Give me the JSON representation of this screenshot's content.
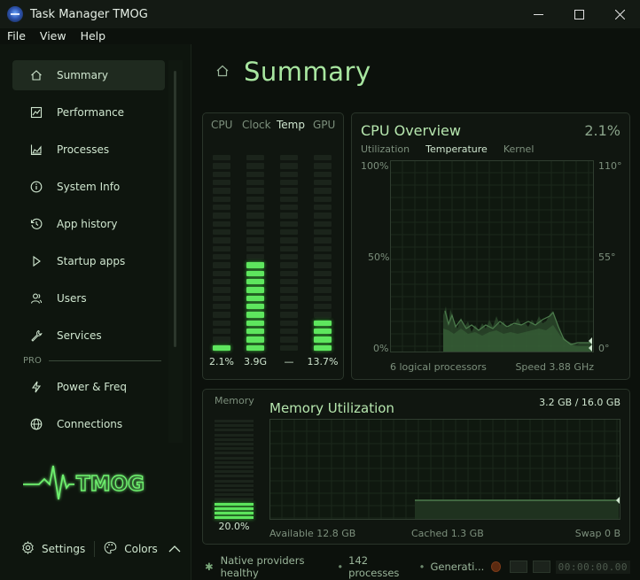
{
  "window": {
    "title": "Task Manager TMOG"
  },
  "menu": [
    "File",
    "View",
    "Help"
  ],
  "sidebar": {
    "items": [
      {
        "label": "Summary",
        "icon": "home-icon",
        "active": true
      },
      {
        "label": "Performance",
        "icon": "chart-icon"
      },
      {
        "label": "Processes",
        "icon": "area-chart-icon"
      },
      {
        "label": "System Info",
        "icon": "info-icon"
      },
      {
        "label": "App history",
        "icon": "history-icon"
      },
      {
        "label": "Startup apps",
        "icon": "play-icon"
      },
      {
        "label": "Users",
        "icon": "users-icon"
      },
      {
        "label": "Services",
        "icon": "wrench-icon"
      }
    ],
    "section_label": "PRO",
    "pro_items": [
      {
        "label": "Power & Freq",
        "icon": "bolt-icon"
      },
      {
        "label": "Connections",
        "icon": "globe-icon"
      }
    ],
    "logo_text": "TMOG",
    "settings_label": "Settings",
    "colors_label": "Colors"
  },
  "main": {
    "title": "Summary",
    "meters": {
      "headers": [
        "CPU",
        "Clock",
        "Temp",
        "GPU"
      ],
      "values": [
        "2.1%",
        "3.9G",
        "—",
        "13.7%"
      ],
      "levels": [
        0.021,
        0.55,
        0,
        0.137
      ],
      "segments": 24,
      "lit_segments": [
        1,
        11,
        0,
        4
      ]
    },
    "cpu_overview": {
      "title": "CPU Overview",
      "percent": "2.1%",
      "tabs": [
        "Utilization",
        "Temperature",
        "Kernel"
      ],
      "selected_tab": "Temperature",
      "left_axis": [
        "100%",
        "50%",
        "0%"
      ],
      "right_axis": [
        "110°",
        "55°",
        "0°"
      ],
      "footer_left": "6 logical processors",
      "footer_right": "Speed 3.88 GHz"
    },
    "memory": {
      "label": "Memory",
      "title": "Memory Utilization",
      "total": "3.2 GB / 16.0 GB",
      "percent": "20.0%",
      "level": 0.2,
      "available": "Available 12.8 GB",
      "cached": "Cached 1.3 GB",
      "swap": "Swap 0 B"
    },
    "status": {
      "health": "Native providers healthy",
      "processes": "142 processes",
      "generating": "Generati...",
      "clock": "00:00:00.00"
    }
  },
  "colors": {
    "accent": "#5ee65e",
    "accent_dim": "#1d2a1d",
    "background": "#0c110c"
  }
}
